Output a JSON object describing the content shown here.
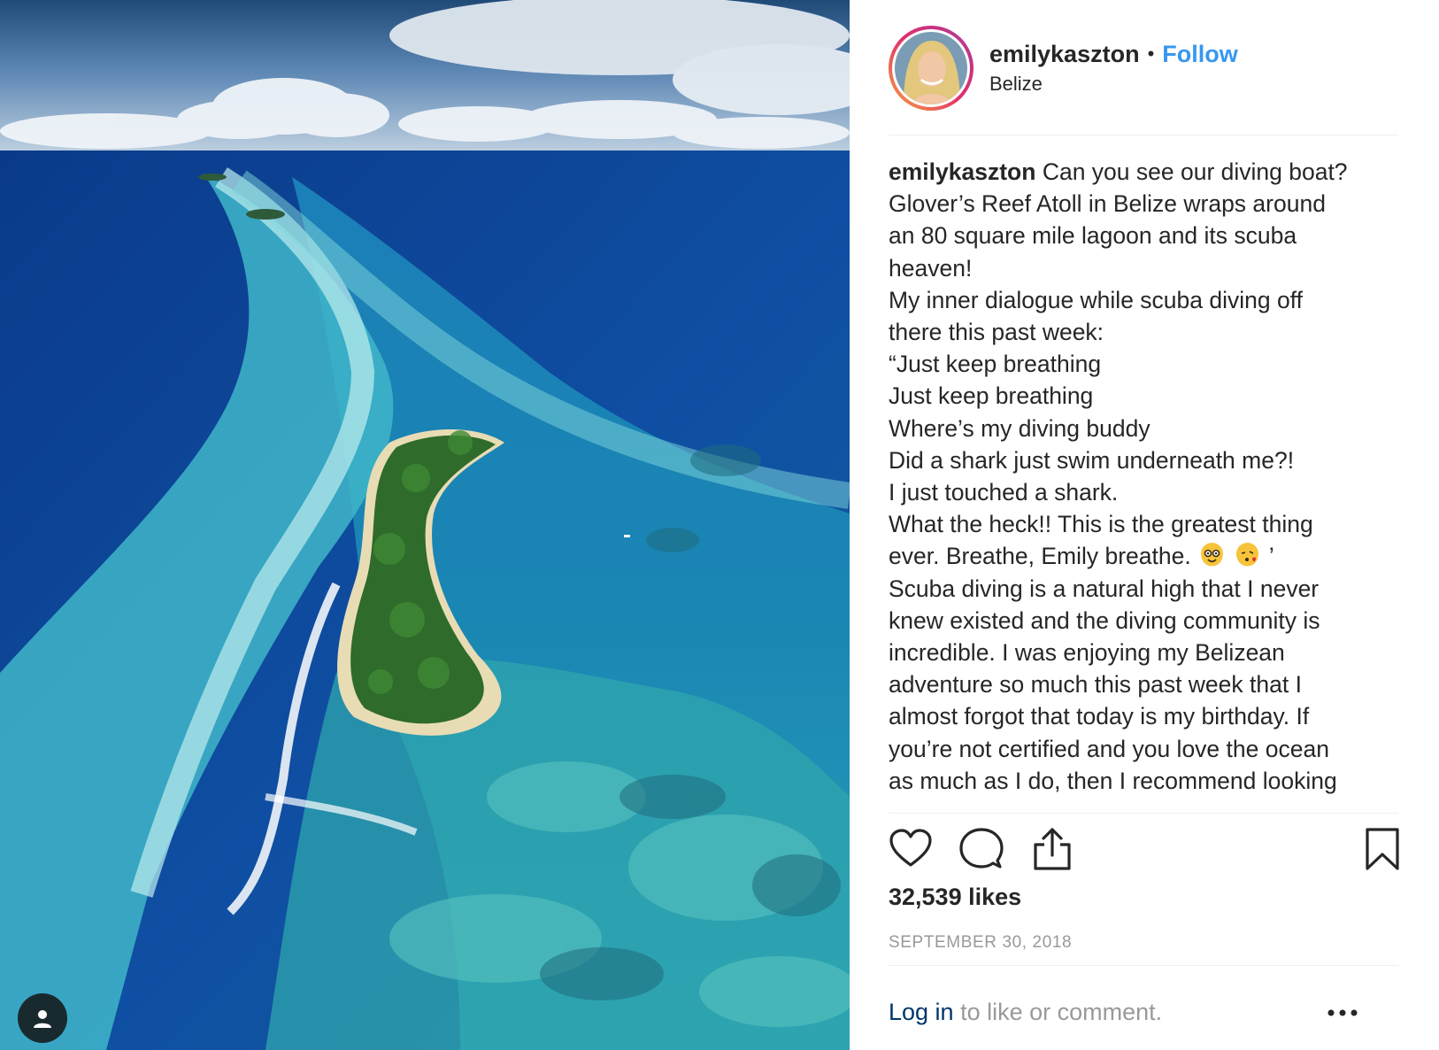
{
  "post": {
    "username": "emilykaszton",
    "separator": "•",
    "follow_label": "Follow",
    "location": "Belize",
    "caption_username": "emilykaszton",
    "caption_lines": [
      "Can you see our diving boat?",
      "Glover’s Reef Atoll in Belize wraps around",
      "an 80 square mile lagoon and its scuba",
      "heaven!",
      "My inner dialogue while scuba diving off",
      "there this past week:",
      "“Just keep breathing",
      "Just keep breathing",
      "Where’s my diving buddy",
      "Did a shark just swim underneath me?!",
      "I just touched a shark.",
      "What the heck!! This is the greatest thing",
      "ever. Breathe, Emily breathe.",
      "Scuba diving is a natural high that I never",
      "knew existed and the diving community is",
      "incredible. I was enjoying my Belizean",
      "adventure so much this past week that I",
      "almost forgot that today is my birthday. If",
      "you’re not certified and you love the ocean",
      "as much as I do, then I recommend looking"
    ],
    "caption_emoji_tail": "’",
    "emojis": [
      "nerd-face-emoji",
      "face-blowing-kiss-emoji"
    ],
    "likes": "32,539 likes",
    "date": "SEPTEMBER 30, 2018",
    "footer_login": "Log in",
    "footer_rest": " to like or comment."
  },
  "icons": {
    "like": "heart-icon",
    "comment": "comment-icon",
    "share": "share-icon",
    "save": "bookmark-icon",
    "more": "more-options-icon",
    "tagged_user": "user-tag-icon"
  },
  "colors": {
    "follow": "#3897f0",
    "login": "#003569",
    "muted": "#999999",
    "text": "#262626"
  }
}
